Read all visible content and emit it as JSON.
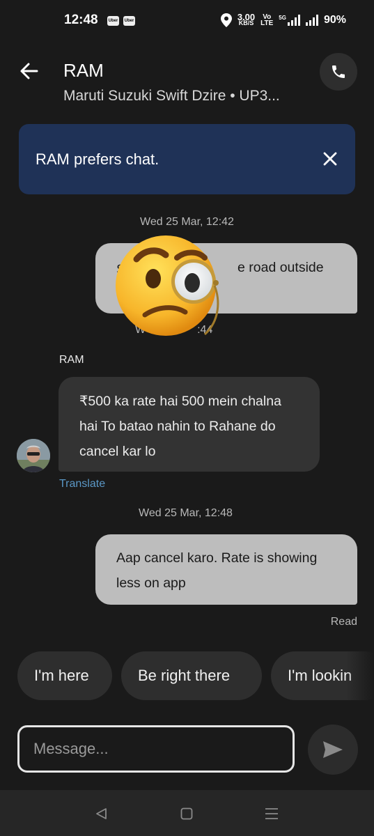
{
  "status_bar": {
    "time": "12:48",
    "app_icons": [
      "Uber",
      "Uber"
    ],
    "location_icon": "location-pin-icon",
    "net_speed": "3.00",
    "net_unit": "KB/S",
    "vo_lte_top": "Vo",
    "vo_lte_bottom": "LTE",
    "signal_label": "5G",
    "battery": "90%"
  },
  "header": {
    "back_icon": "arrow-left-icon",
    "driver_name": "RAM",
    "vehicle": "Maruti Suzuki Swift Dzire • UP3...",
    "call_icon": "phone-icon"
  },
  "banner": {
    "text": "RAM prefers chat.",
    "close_icon": "close-icon",
    "color": "#1f3257"
  },
  "messages": [
    {
      "type": "timestamp",
      "text": "Wed 25 Mar, 12:42"
    },
    {
      "type": "outgoing",
      "visible_text": "e road outside"
    },
    {
      "type": "timestamp",
      "visible_text": ":44",
      "prefix": "W"
    },
    {
      "type": "incoming",
      "sender": "RAM",
      "text": "₹500 ka rate hai 500 mein chalna hai To batao nahin to Rahane do cancel kar lo",
      "translate_label": "Translate"
    },
    {
      "type": "timestamp",
      "text": "Wed 25 Mar, 12:48"
    },
    {
      "type": "outgoing",
      "text": "Aap cancel karo. Rate is showing less on app",
      "status": "Read"
    }
  ],
  "quick_replies": [
    "I'm here",
    "Be right there",
    "I'm lookin"
  ],
  "composer": {
    "placeholder": "Message...",
    "send_icon": "send-icon"
  },
  "nav_bar": {
    "back_icon": "triangle-back-icon",
    "home_icon": "square-home-icon",
    "recents_icon": "menu-lines-icon"
  },
  "overlay": {
    "emoji": "face-with-monocle-emoji"
  },
  "colors": {
    "background": "#1a1a1a",
    "outgoing_bubble": "#bdbdbd",
    "incoming_bubble": "#333333",
    "link": "#5b98c7"
  }
}
